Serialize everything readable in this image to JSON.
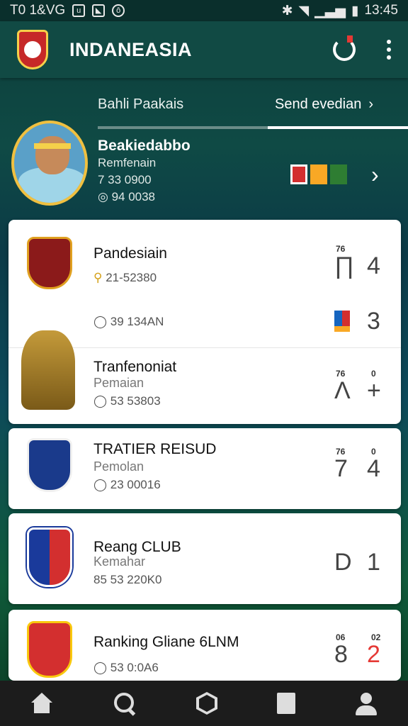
{
  "status_bar": {
    "left_text": "T0 1&VG",
    "time": "13:45"
  },
  "app_bar": {
    "title": "INDANEASIA"
  },
  "hero": {
    "tab_left": "Bahli Paakais",
    "tab_right": "Send evedian",
    "tab_right_chevron": "›",
    "player_name": "Beakiedabbo",
    "player_sub": "Remfenain",
    "stat_1": "7  33 0900",
    "stat_2": "94 0038",
    "flag_colors": [
      "#d32f2f",
      "#f9a825",
      "#2e7d32"
    ],
    "chevron": "›"
  },
  "cards": [
    {
      "title": "Pandesiain",
      "meta": "21-52380",
      "score_small": "76",
      "score_big_left": "∏",
      "score_big_right": "4",
      "row2_meta": "39 134AN",
      "row2_score": "3"
    },
    {
      "title": "Tranfenoniat",
      "sub": "Pemaian",
      "meta": "53 53803",
      "score_small_left": "76",
      "score_small_right": "0",
      "score_big_left": "Λ",
      "score_big_right": "+"
    },
    {
      "title": "TRATIER REISUD",
      "sub": "Pemolan",
      "meta": "23 00016",
      "score_small_left": "76",
      "score_small_right": "0",
      "score_big_left": "7",
      "score_big_right": "4"
    },
    {
      "title": "Reang CLUB",
      "sub": "Kemahar",
      "meta": "53 220K0",
      "meta_prefix": "85",
      "score_big_left": "D",
      "score_big_right": "1"
    },
    {
      "title": "Ranking Gliane 6LNM",
      "meta": "53 0:0A6",
      "score_small_left": "06",
      "score_small_right": "02",
      "score_big_left": "8",
      "score_big_right": "2"
    }
  ],
  "colors": {
    "accent_green": "#2fbf5a",
    "accent_red": "#e53935",
    "app_bar": "#114a44"
  },
  "bottom_nav": [
    "home-icon",
    "search-icon",
    "hexagon-icon",
    "square-icon",
    "user-icon"
  ]
}
